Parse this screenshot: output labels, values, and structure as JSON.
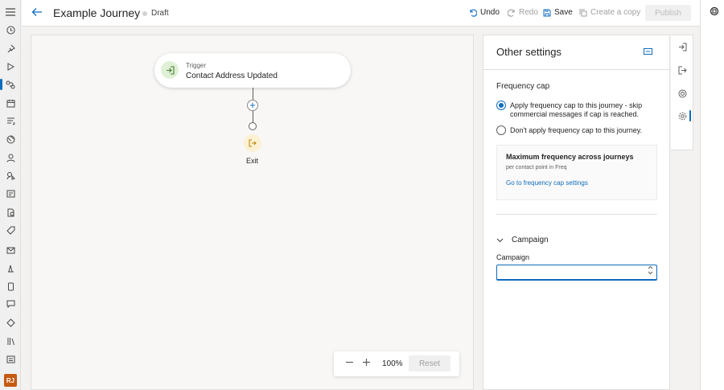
{
  "header": {
    "title": "Example Journey",
    "status": "Draft",
    "undo": "Undo",
    "redo": "Redo",
    "save": "Save",
    "create_copy": "Create a copy",
    "publish": "Publish"
  },
  "rail": {
    "icons": [
      "hamburger-menu-icon",
      "recent-icon",
      "pin-icon",
      "play-icon",
      "journeys-icon",
      "calendar-icon",
      "segments-icon",
      "globe-icon",
      "person-icon",
      "contact-point-icon",
      "forms-icon",
      "documents-icon",
      "tag-icon",
      "email-icon",
      "library-icon",
      "phone-icon",
      "chat-icon",
      "branch-icon",
      "books-icon",
      "list-icon"
    ],
    "active_index": 4,
    "avatar": "RJ"
  },
  "canvas": {
    "trigger_label": "Trigger",
    "trigger_name": "Contact Address Updated",
    "exit_label": "Exit",
    "zoom_level": "100%",
    "reset_label": "Reset"
  },
  "panel": {
    "title": "Other settings",
    "frequency_cap": {
      "title": "Frequency cap",
      "option_apply": "Apply frequency cap to this journey - skip commercial messages if cap is reached.",
      "option_dont": "Don't apply frequency cap to this journey.",
      "selected": "apply",
      "box_heading": "Maximum frequency across journeys",
      "box_sub": "per contact point in Freq",
      "box_link": "Go to frequency cap settings"
    },
    "campaign": {
      "section_title": "Campaign",
      "field_label": "Campaign",
      "value": "",
      "placeholder": ""
    }
  },
  "side_tabs": [
    "entry-icon",
    "exit-icon",
    "goal-icon",
    "settings-icon"
  ],
  "colors": {
    "accent": "#0f6cbd",
    "trigger_bg": "#dff0d6",
    "exit_bg": "#fdf0d3",
    "avatar": "#c55a11"
  }
}
